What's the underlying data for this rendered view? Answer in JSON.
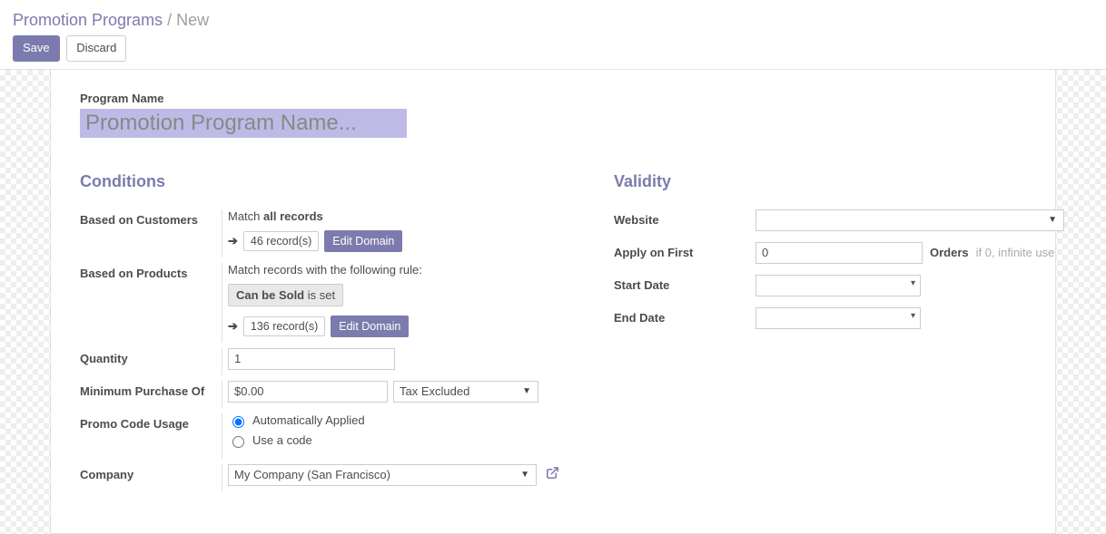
{
  "breadcrumb": {
    "parent": "Promotion Programs",
    "sep": "/",
    "current": "New"
  },
  "actions": {
    "save": "Save",
    "discard": "Discard"
  },
  "form": {
    "program_name_label": "Program Name",
    "program_name_placeholder": "Promotion Program Name..."
  },
  "conditions": {
    "title": "Conditions",
    "based_on_customers": {
      "label": "Based on Customers",
      "match_prefix": "Match ",
      "match_strong": "all records",
      "record_count": "46 record(s)",
      "edit_domain": "Edit Domain"
    },
    "based_on_products": {
      "label": "Based on Products",
      "match_text": "Match records with the following rule:",
      "rule_field": "Can be Sold",
      "rule_op": "is set",
      "record_count": "136 record(s)",
      "edit_domain": "Edit Domain"
    },
    "quantity": {
      "label": "Quantity",
      "value": "1"
    },
    "min_purchase": {
      "label": "Minimum Purchase Of",
      "value": "$0.00",
      "tax_option": "Tax Excluded"
    },
    "promo_usage": {
      "label": "Promo Code Usage",
      "auto": "Automatically Applied",
      "code": "Use a code"
    },
    "company": {
      "label": "Company",
      "value": "My Company (San Francisco)"
    }
  },
  "validity": {
    "title": "Validity",
    "website": {
      "label": "Website",
      "value": ""
    },
    "apply_first": {
      "label": "Apply on First",
      "value": "0",
      "orders_label": "Orders",
      "hint": "if 0, infinite use"
    },
    "start_date": {
      "label": "Start Date",
      "value": ""
    },
    "end_date": {
      "label": "End Date",
      "value": ""
    }
  }
}
